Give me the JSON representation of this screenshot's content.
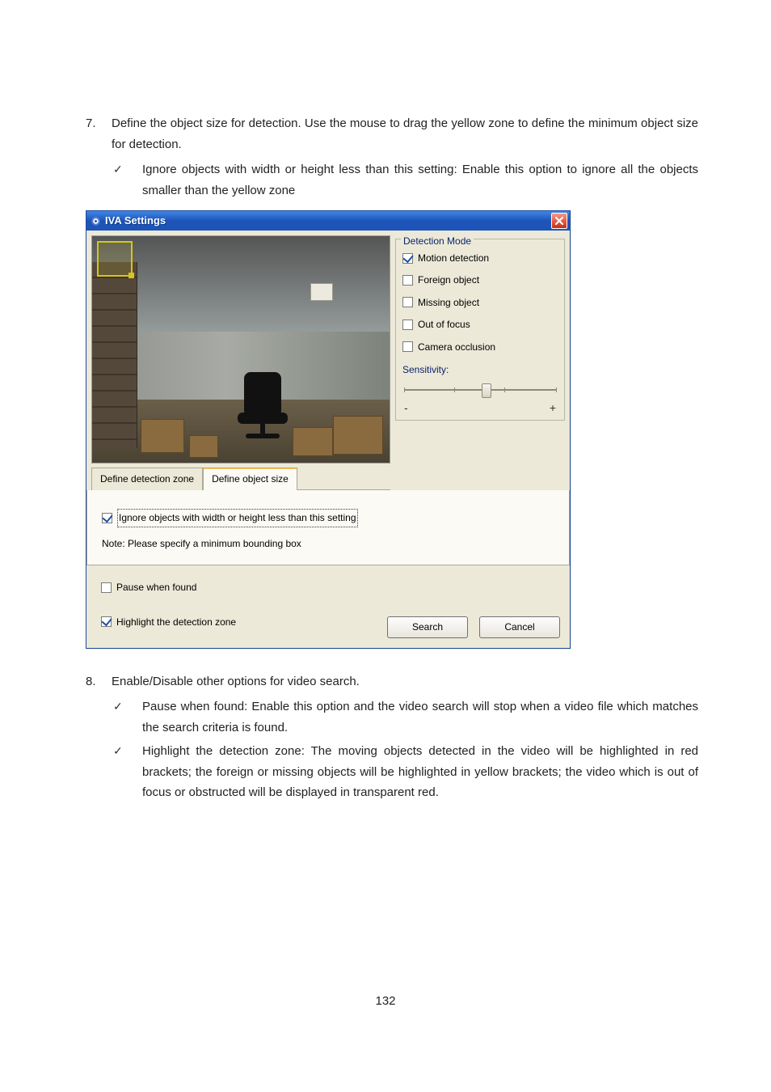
{
  "page_number": "132",
  "step7": {
    "num": "7.",
    "text": "Define the object size for detection.   Use the mouse to drag the yellow zone to define the minimum object size for detection.",
    "bullets": [
      {
        "text": "Ignore objects with width or height less than this setting: Enable this option to ignore all the objects smaller than the yellow zone"
      }
    ]
  },
  "dialog": {
    "title": "IVA Settings",
    "detection_mode": {
      "legend": "Detection Mode",
      "items": [
        {
          "label": "Motion detection",
          "checked": true
        },
        {
          "label": "Foreign object",
          "checked": false
        },
        {
          "label": "Missing object",
          "checked": false
        },
        {
          "label": "Out of focus",
          "checked": false
        },
        {
          "label": "Camera occlusion",
          "checked": false
        }
      ],
      "sensitivity_label": "Sensitivity:",
      "slider": {
        "value_pct": 54,
        "ticks": [
          0,
          33,
          66,
          100
        ],
        "minus": "-",
        "plus": "+"
      }
    },
    "tabs": {
      "items": [
        {
          "label": "Define detection zone",
          "active": false
        },
        {
          "label": "Define object size",
          "active": true
        }
      ],
      "panel": {
        "ignore": {
          "label": "Ignore objects with width or height less than this setting",
          "checked": true
        },
        "note": "Note: Please specify a minimum bounding box"
      }
    },
    "options": {
      "pause": {
        "label": "Pause when found",
        "checked": false
      },
      "highlight": {
        "label": "Highlight the detection zone",
        "checked": true
      }
    },
    "buttons": {
      "search": "Search",
      "cancel": "Cancel"
    }
  },
  "step8": {
    "num": "8.",
    "text": "Enable/Disable other options for video search.",
    "bullets": [
      {
        "text": "Pause when found: Enable this option and the video search will stop when a video file which matches the search criteria is found."
      },
      {
        "text": "Highlight the detection zone: The moving objects detected in the video will be highlighted in red brackets; the foreign or missing objects will be highlighted in yellow brackets; the video which is out of focus or obstructed will be displayed in transparent red."
      }
    ]
  }
}
